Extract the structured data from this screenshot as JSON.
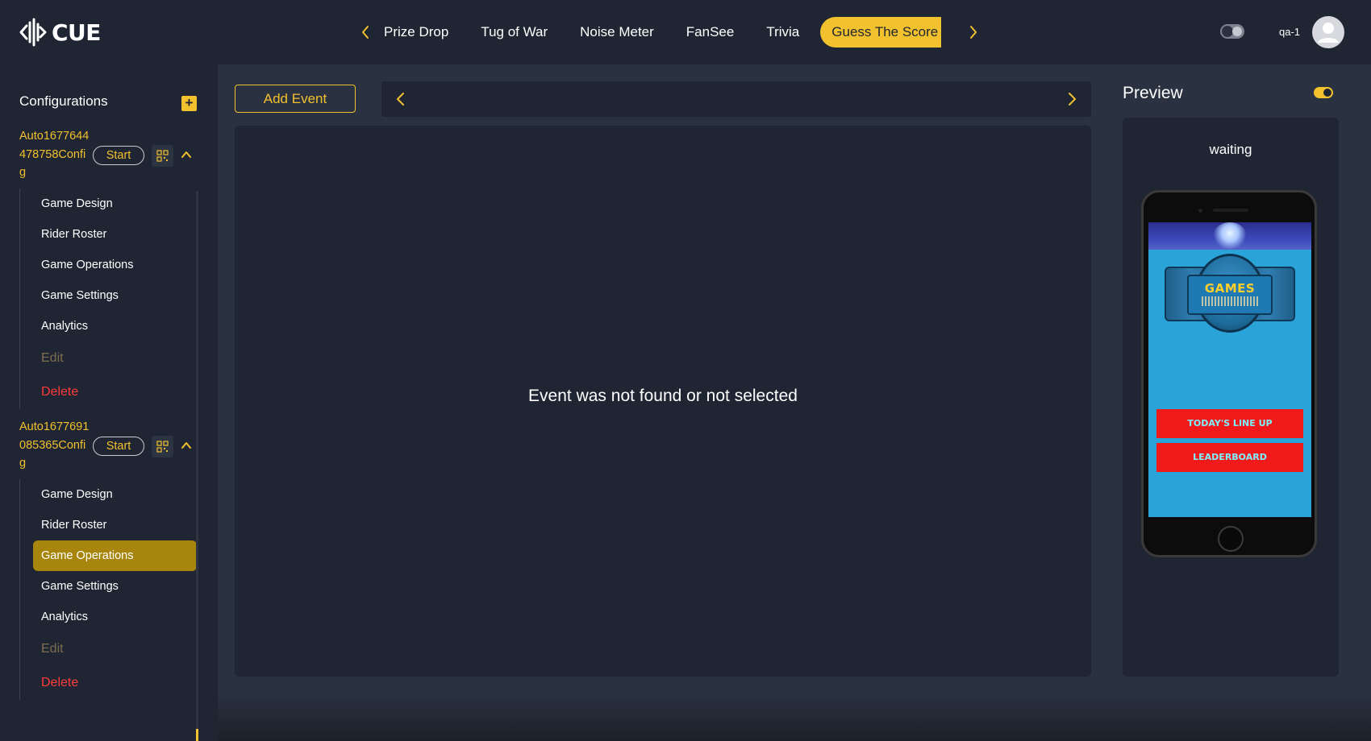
{
  "app": {
    "logo_text": "CUE",
    "accent_color": "#f2c12e"
  },
  "header": {
    "tabs": [
      {
        "label": "Prize Drop",
        "active": false
      },
      {
        "label": "Tug of War",
        "active": false
      },
      {
        "label": "Noise Meter",
        "active": false
      },
      {
        "label": "FanSee",
        "active": false
      },
      {
        "label": "Trivia",
        "active": false
      },
      {
        "label": "Guess The Score",
        "active": true
      }
    ],
    "username": "qa-1"
  },
  "sidebar": {
    "title": "Configurations",
    "configs": [
      {
        "name": "Auto1677644478758Config",
        "start_label": "Start",
        "items": [
          "Game Design",
          "Rider Roster",
          "Game Operations",
          "Game Settings",
          "Analytics"
        ],
        "edit_label": "Edit",
        "delete_label": "Delete"
      },
      {
        "name": "Auto1677691085365Config",
        "start_label": "Start",
        "items": [
          "Game Design",
          "Rider Roster",
          "Game Operations",
          "Game Settings",
          "Analytics"
        ],
        "active_item": "Game Operations",
        "edit_label": "Edit",
        "delete_label": "Delete"
      }
    ]
  },
  "main": {
    "add_event_label": "Add Event",
    "empty_message": "Event was not found or not selected"
  },
  "preview": {
    "title": "Preview",
    "status": "waiting",
    "toggle_on": true,
    "phone": {
      "logo_label": "GAMES",
      "buttons": [
        "Today's Line Up",
        "Leaderboard"
      ]
    }
  }
}
